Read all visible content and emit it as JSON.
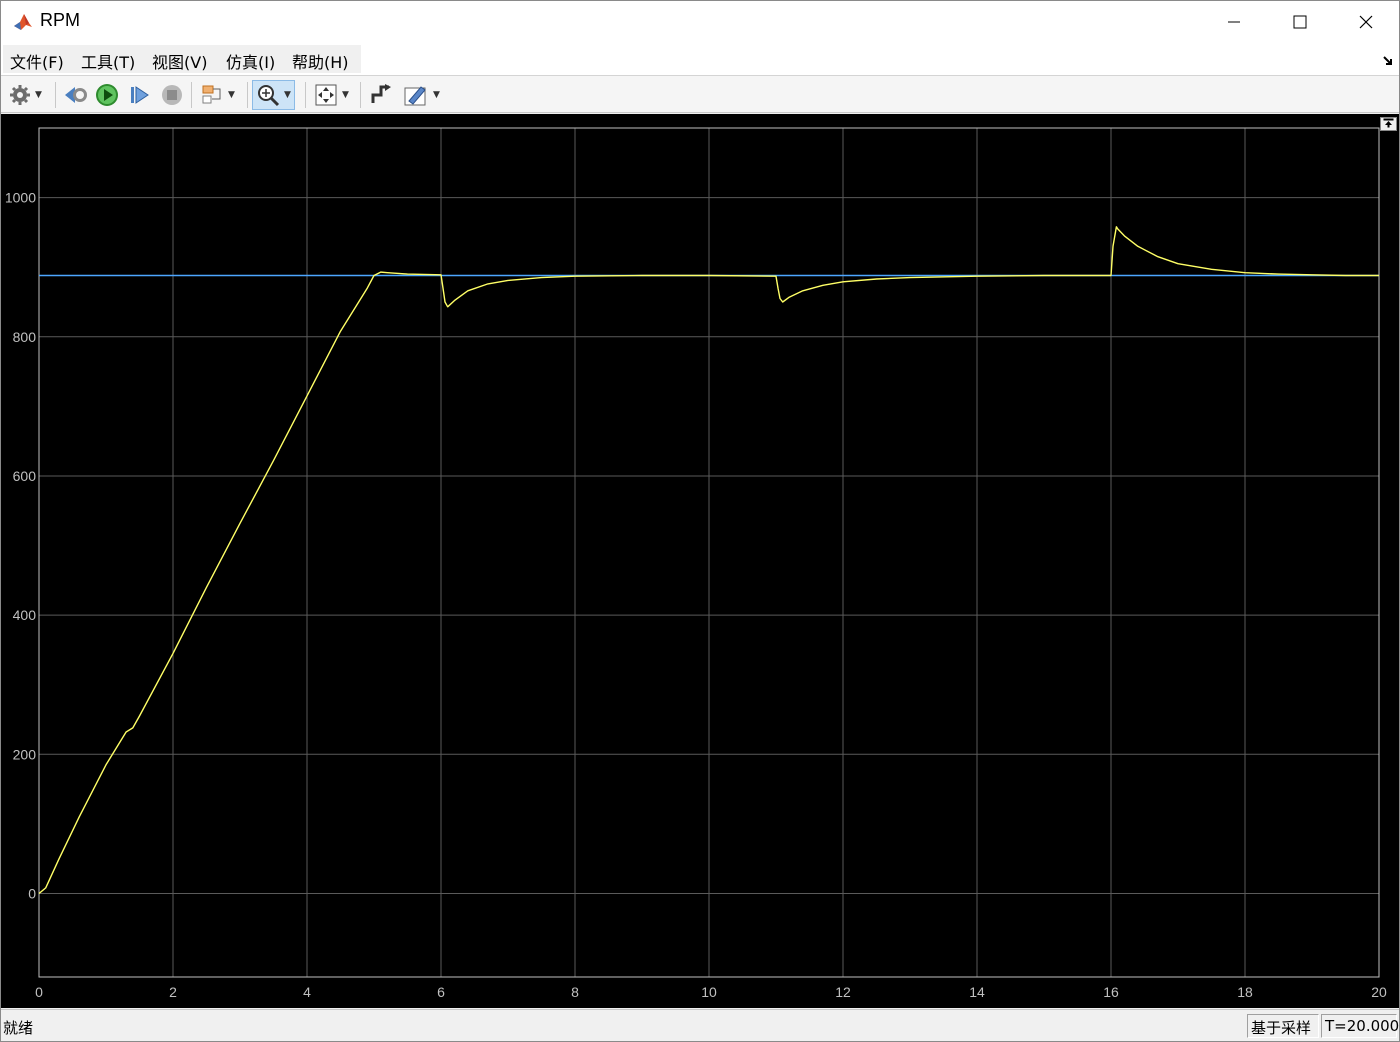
{
  "window": {
    "title": "RPM",
    "controls": [
      "minimize",
      "maximize",
      "close"
    ]
  },
  "menu": {
    "items": [
      "文件(F)",
      "工具(T)",
      "视图(V)",
      "仿真(I)",
      "帮助(H)"
    ]
  },
  "toolbar": {
    "buttons": [
      "gear-icon",
      "step-back-icon",
      "run-icon",
      "step-forward-icon",
      "stop-icon",
      "signal-select-icon",
      "zoom-icon",
      "autoscale-icon",
      "highlight-block-icon",
      "style-icon"
    ]
  },
  "status": {
    "left": "就绪",
    "mode": "基于采样",
    "time": "T=20.000"
  },
  "colors": {
    "background": "#000000",
    "grid": "#5a5a5a",
    "axis": "#c0c0c0",
    "series_yellow": "#ffff66",
    "series_blue": "#4da6ff"
  },
  "chart_data": {
    "type": "line",
    "title": "",
    "xlabel": "",
    "ylabel": "",
    "xlim": [
      0,
      20
    ],
    "ylim": [
      -120,
      1100
    ],
    "x_ticks": [
      0,
      2,
      4,
      6,
      8,
      10,
      12,
      14,
      16,
      18,
      20
    ],
    "y_ticks": [
      0,
      200,
      400,
      600,
      800,
      1000
    ],
    "grid": true,
    "series": [
      {
        "color": "#4da6ff",
        "x": [
          0,
          20
        ],
        "y": [
          888,
          888
        ]
      },
      {
        "color": "#ffff66",
        "x": [
          0,
          0.1,
          0.3,
          0.6,
          1.0,
          1.3,
          1.4,
          1.5,
          2.0,
          2.5,
          3.0,
          3.5,
          4.0,
          4.5,
          4.9,
          5.0,
          5.1,
          5.2,
          5.5,
          6.0,
          6.03,
          6.06,
          6.1,
          6.2,
          6.4,
          6.7,
          7.0,
          7.5,
          8.0,
          9.0,
          10.0,
          11.0,
          11.03,
          11.06,
          11.1,
          11.2,
          11.4,
          11.7,
          12.0,
          12.5,
          13.0,
          14.0,
          15.0,
          16.0,
          16.03,
          16.08,
          16.1,
          16.2,
          16.4,
          16.7,
          17.0,
          17.5,
          18.0,
          18.5,
          19.0,
          19.5,
          20.0
        ],
        "y": [
          0,
          8,
          50,
          110,
          185,
          232,
          238,
          255,
          345,
          440,
          532,
          622,
          715,
          808,
          870,
          888,
          893,
          892,
          890,
          889,
          870,
          850,
          843,
          852,
          866,
          876,
          881,
          885,
          887,
          888,
          888,
          887,
          870,
          855,
          850,
          857,
          866,
          874,
          879,
          883,
          885,
          887,
          888,
          888,
          930,
          958,
          955,
          945,
          930,
          915,
          905,
          897,
          892,
          890,
          889,
          888,
          888
        ]
      }
    ]
  }
}
